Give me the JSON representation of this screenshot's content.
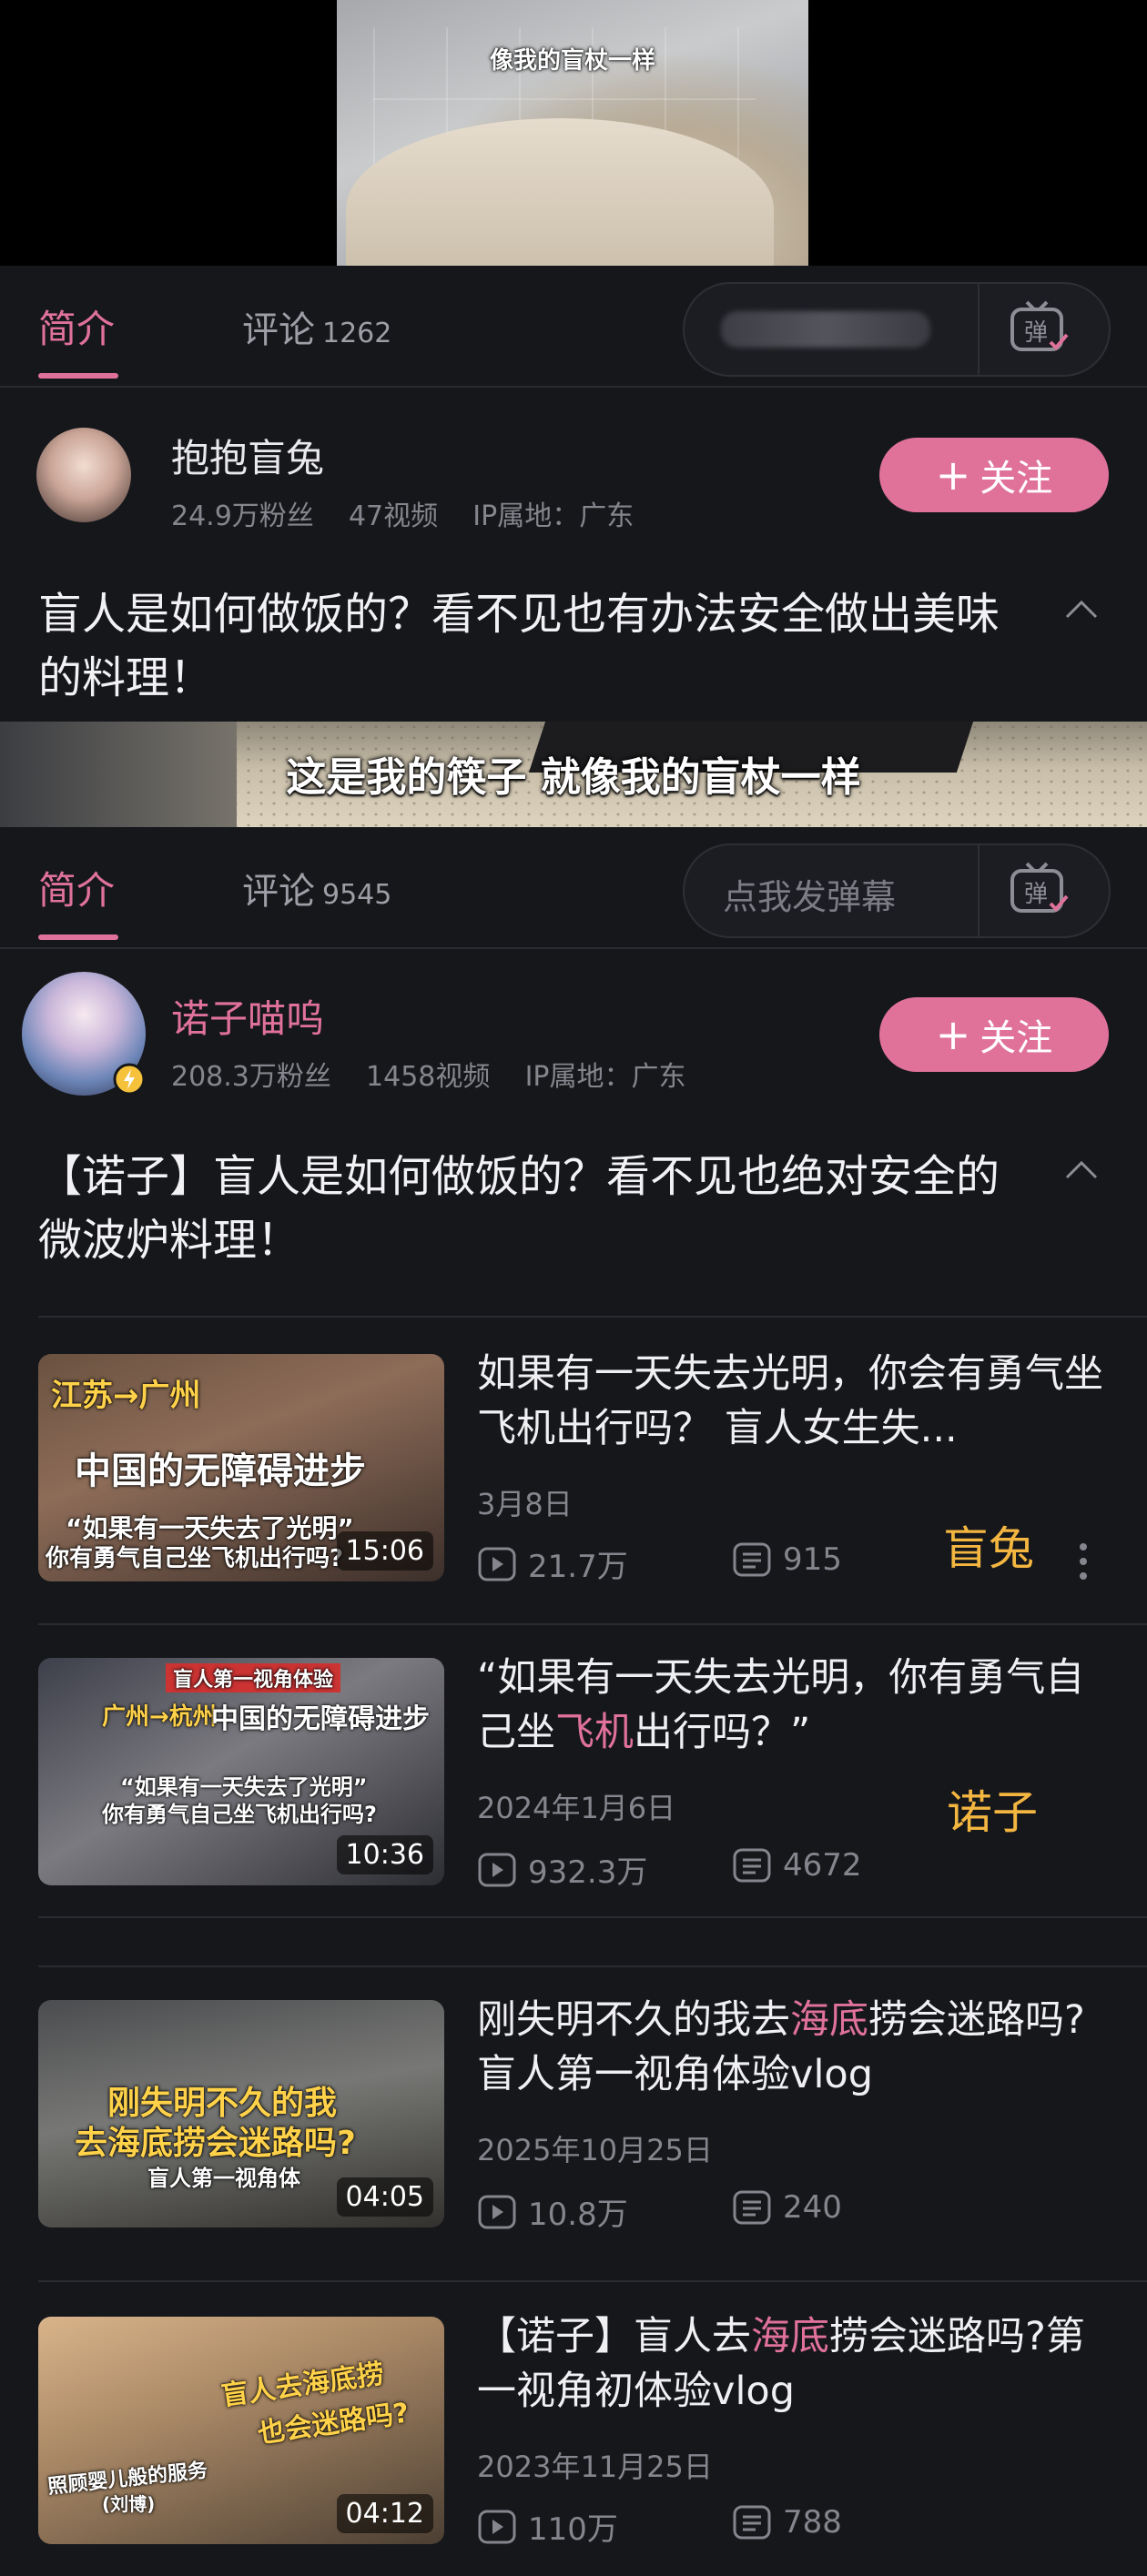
{
  "top_video": {
    "subtitle": "像我的盲杖一样"
  },
  "section1": {
    "tabs": {
      "intro": "简介",
      "comments": "评论",
      "comments_count": "1262"
    },
    "author": {
      "name": "抱抱盲兔",
      "fans": "24.9万粉丝",
      "videos": "47视频",
      "ip": "IP属地：广东"
    },
    "follow_label": "关注",
    "video_title": "盲人是如何做饭的？看不见也有办法安全做出美味的料理！"
  },
  "mid_video": {
    "subtitle": "这是我的筷子 就像我的盲杖一样"
  },
  "section2": {
    "tabs": {
      "intro": "简介",
      "comments": "评论",
      "comments_count": "9545"
    },
    "danmu_placeholder": "点我发弹幕",
    "author": {
      "name": "诺子喵呜",
      "fans": "208.3万粉丝",
      "videos": "1458视频",
      "ip": "IP属地：广东"
    },
    "follow_label": "关注",
    "video_title": "【诺子】盲人是如何做饭的？看不见也绝对安全的微波炉料理！"
  },
  "videos": [
    {
      "title": "如果有一天失去光明，你会有勇气坐飞机出行吗？ 盲人女生失...",
      "date": "3月8日",
      "plays": "21.7万",
      "danmaku": "915",
      "duration": "15:06",
      "tag": "盲兔",
      "thumb_text": [
        "江苏→广州",
        "中国的无障碍进步",
        "“如果有一天失去了光明”",
        "你有勇气自己坐飞机出行吗?"
      ]
    },
    {
      "title_pre": "“如果有一天失去光明，你有勇气自己坐",
      "title_hl": "飞机",
      "title_post": "出行吗？”",
      "date": "2024年1月6日",
      "plays": "932.3万",
      "danmaku": "4672",
      "duration": "10:36",
      "tag": "诺子",
      "thumb_text": [
        "盲人第一视角体验",
        "广州→杭州",
        "中国的无障碍进步",
        "“如果有一天失去了光明”",
        "你有勇气自己坐飞机出行吗?"
      ]
    },
    {
      "title_pre": "刚失明不久的我去",
      "title_hl": "海底",
      "title_post": "捞会迷路吗?盲人第一视角体验vlog",
      "date": "2025年10月25日",
      "plays": "10.8万",
      "danmaku": "240",
      "duration": "04:05",
      "thumb_text": [
        "刚失明不久的我",
        "去海底捞会迷路吗?",
        "盲人第一视角体"
      ]
    },
    {
      "title_pre": "【诺子】盲人去",
      "title_hl": "海底",
      "title_post": "捞会迷路吗?第一视角初体验vlog",
      "date": "2023年11月25日",
      "plays": "110万",
      "danmaku": "788",
      "duration": "04:12",
      "thumb_text": [
        "盲人去海底捞",
        "也会迷路吗?",
        "照顾婴儿般的服务",
        "(刘博)"
      ]
    }
  ]
}
